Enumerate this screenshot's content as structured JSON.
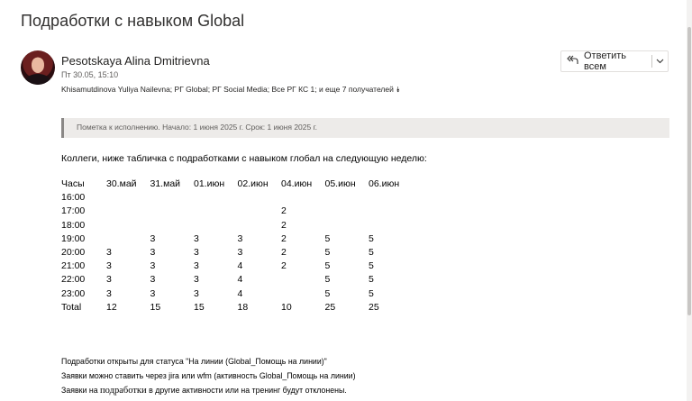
{
  "email": {
    "subject": "Подработки с навыком Global",
    "sender": "Pesotskaya Alina Dmitrievna",
    "date": "Пт 30.05, 15:10",
    "recipients": "Khisamutdinova Yuliya Nailevna; РГ Global; РГ Social Media; Все РГ КС 1;",
    "recipients_more": " и еще 7 получателей ",
    "recipients_more_icon": "double-chevron-down-icon",
    "reply_all_label": "Ответить всем",
    "reply_icon": "reply-all-icon",
    "reply_chevron_icon": "chevron-down-icon",
    "flag_text": "Пометка к исполнению. Начало: 1 июня 2025 г. Срок: 1 июня 2025 г.",
    "intro": "Коллеги, ниже табличка с подработками с навыком глобал на следующую неделю:"
  },
  "schedule": {
    "headers": [
      "Часы",
      "30.май",
      "31.май",
      "01.июн",
      "02.июн",
      "04.июн",
      "05.июн",
      "06.июн"
    ],
    "rows": [
      [
        "16:00",
        "",
        "",
        "",
        "",
        "",
        "",
        ""
      ],
      [
        "17:00",
        "",
        "",
        "",
        "",
        "2",
        "",
        ""
      ],
      [
        "18:00",
        "",
        "",
        "",
        "",
        "2",
        "",
        ""
      ],
      [
        "19:00",
        "",
        "3",
        "3",
        "3",
        "2",
        "5",
        "5"
      ],
      [
        "20:00",
        "3",
        "3",
        "3",
        "3",
        "2",
        "5",
        "5"
      ],
      [
        "21:00",
        "3",
        "3",
        "3",
        "4",
        "2",
        "5",
        "5"
      ],
      [
        "22:00",
        "3",
        "3",
        "3",
        "4",
        "",
        "5",
        "5"
      ],
      [
        "23:00",
        "3",
        "3",
        "3",
        "4",
        "",
        "5",
        "5"
      ],
      [
        "Total",
        "12",
        "15",
        "15",
        "18",
        "10",
        "25",
        "25"
      ]
    ]
  },
  "notes": {
    "line1": "Подработки открыты для статуса \"На линии (Global_Помощь на линии)\"",
    "line2": "Заявки можно ставить через jira или wfm (активность Global_Помощь на линии)",
    "line3_a": "Заявки на ",
    "line3_b": "подработки",
    "line3_c": " в другие активности или на тренинг будут отклонены."
  }
}
